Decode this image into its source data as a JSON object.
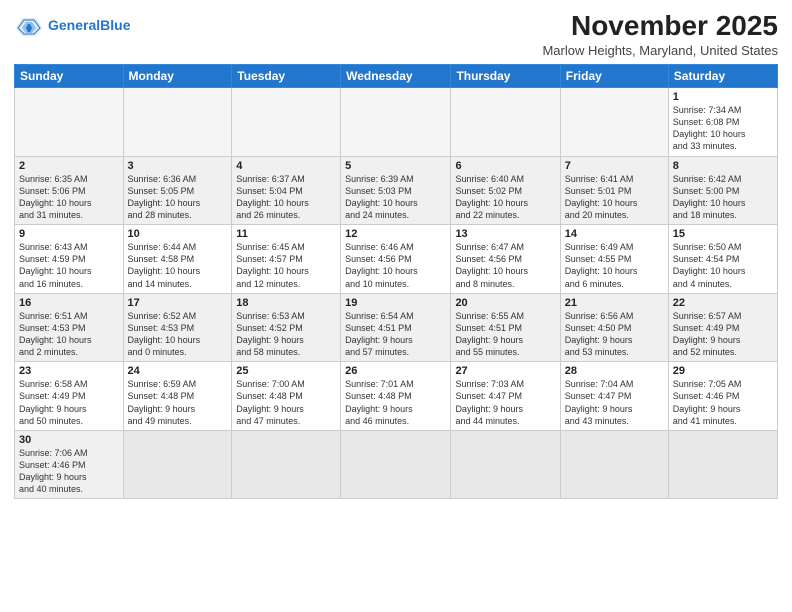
{
  "header": {
    "logo_general": "General",
    "logo_blue": "Blue",
    "month": "November 2025",
    "location": "Marlow Heights, Maryland, United States"
  },
  "days_of_week": [
    "Sunday",
    "Monday",
    "Tuesday",
    "Wednesday",
    "Thursday",
    "Friday",
    "Saturday"
  ],
  "weeks": [
    [
      {
        "num": "",
        "info": "",
        "empty": true
      },
      {
        "num": "",
        "info": "",
        "empty": true
      },
      {
        "num": "",
        "info": "",
        "empty": true
      },
      {
        "num": "",
        "info": "",
        "empty": true
      },
      {
        "num": "",
        "info": "",
        "empty": true
      },
      {
        "num": "",
        "info": "",
        "empty": true
      },
      {
        "num": "1",
        "info": "Sunrise: 7:34 AM\nSunset: 6:08 PM\nDaylight: 10 hours\nand 33 minutes."
      }
    ],
    [
      {
        "num": "2",
        "info": "Sunrise: 6:35 AM\nSunset: 5:06 PM\nDaylight: 10 hours\nand 31 minutes."
      },
      {
        "num": "3",
        "info": "Sunrise: 6:36 AM\nSunset: 5:05 PM\nDaylight: 10 hours\nand 28 minutes."
      },
      {
        "num": "4",
        "info": "Sunrise: 6:37 AM\nSunset: 5:04 PM\nDaylight: 10 hours\nand 26 minutes."
      },
      {
        "num": "5",
        "info": "Sunrise: 6:39 AM\nSunset: 5:03 PM\nDaylight: 10 hours\nand 24 minutes."
      },
      {
        "num": "6",
        "info": "Sunrise: 6:40 AM\nSunset: 5:02 PM\nDaylight: 10 hours\nand 22 minutes."
      },
      {
        "num": "7",
        "info": "Sunrise: 6:41 AM\nSunset: 5:01 PM\nDaylight: 10 hours\nand 20 minutes."
      },
      {
        "num": "8",
        "info": "Sunrise: 6:42 AM\nSunset: 5:00 PM\nDaylight: 10 hours\nand 18 minutes."
      }
    ],
    [
      {
        "num": "9",
        "info": "Sunrise: 6:43 AM\nSunset: 4:59 PM\nDaylight: 10 hours\nand 16 minutes."
      },
      {
        "num": "10",
        "info": "Sunrise: 6:44 AM\nSunset: 4:58 PM\nDaylight: 10 hours\nand 14 minutes."
      },
      {
        "num": "11",
        "info": "Sunrise: 6:45 AM\nSunset: 4:57 PM\nDaylight: 10 hours\nand 12 minutes."
      },
      {
        "num": "12",
        "info": "Sunrise: 6:46 AM\nSunset: 4:56 PM\nDaylight: 10 hours\nand 10 minutes."
      },
      {
        "num": "13",
        "info": "Sunrise: 6:47 AM\nSunset: 4:56 PM\nDaylight: 10 hours\nand 8 minutes."
      },
      {
        "num": "14",
        "info": "Sunrise: 6:49 AM\nSunset: 4:55 PM\nDaylight: 10 hours\nand 6 minutes."
      },
      {
        "num": "15",
        "info": "Sunrise: 6:50 AM\nSunset: 4:54 PM\nDaylight: 10 hours\nand 4 minutes."
      }
    ],
    [
      {
        "num": "16",
        "info": "Sunrise: 6:51 AM\nSunset: 4:53 PM\nDaylight: 10 hours\nand 2 minutes."
      },
      {
        "num": "17",
        "info": "Sunrise: 6:52 AM\nSunset: 4:53 PM\nDaylight: 10 hours\nand 0 minutes."
      },
      {
        "num": "18",
        "info": "Sunrise: 6:53 AM\nSunset: 4:52 PM\nDaylight: 9 hours\nand 58 minutes."
      },
      {
        "num": "19",
        "info": "Sunrise: 6:54 AM\nSunset: 4:51 PM\nDaylight: 9 hours\nand 57 minutes."
      },
      {
        "num": "20",
        "info": "Sunrise: 6:55 AM\nSunset: 4:51 PM\nDaylight: 9 hours\nand 55 minutes."
      },
      {
        "num": "21",
        "info": "Sunrise: 6:56 AM\nSunset: 4:50 PM\nDaylight: 9 hours\nand 53 minutes."
      },
      {
        "num": "22",
        "info": "Sunrise: 6:57 AM\nSunset: 4:49 PM\nDaylight: 9 hours\nand 52 minutes."
      }
    ],
    [
      {
        "num": "23",
        "info": "Sunrise: 6:58 AM\nSunset: 4:49 PM\nDaylight: 9 hours\nand 50 minutes."
      },
      {
        "num": "24",
        "info": "Sunrise: 6:59 AM\nSunset: 4:48 PM\nDaylight: 9 hours\nand 49 minutes."
      },
      {
        "num": "25",
        "info": "Sunrise: 7:00 AM\nSunset: 4:48 PM\nDaylight: 9 hours\nand 47 minutes."
      },
      {
        "num": "26",
        "info": "Sunrise: 7:01 AM\nSunset: 4:48 PM\nDaylight: 9 hours\nand 46 minutes."
      },
      {
        "num": "27",
        "info": "Sunrise: 7:03 AM\nSunset: 4:47 PM\nDaylight: 9 hours\nand 44 minutes."
      },
      {
        "num": "28",
        "info": "Sunrise: 7:04 AM\nSunset: 4:47 PM\nDaylight: 9 hours\nand 43 minutes."
      },
      {
        "num": "29",
        "info": "Sunrise: 7:05 AM\nSunset: 4:46 PM\nDaylight: 9 hours\nand 41 minutes."
      }
    ],
    [
      {
        "num": "30",
        "info": "Sunrise: 7:06 AM\nSunset: 4:46 PM\nDaylight: 9 hours\nand 40 minutes."
      },
      {
        "num": "",
        "info": "",
        "empty": true
      },
      {
        "num": "",
        "info": "",
        "empty": true
      },
      {
        "num": "",
        "info": "",
        "empty": true
      },
      {
        "num": "",
        "info": "",
        "empty": true
      },
      {
        "num": "",
        "info": "",
        "empty": true
      },
      {
        "num": "",
        "info": "",
        "empty": true
      }
    ]
  ]
}
